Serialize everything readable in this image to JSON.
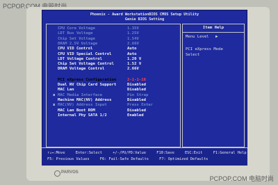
{
  "watermark": {
    "top": "PCPOP.COM 电脑时尚",
    "bottom": "PCPOP.COM 电脑时尚"
  },
  "bios": {
    "title": "Phoenix - Award WorkstationBIOS CMOS Setup Utility",
    "subtitle": "Genie BIOS Setting",
    "rows": [
      {
        "label": "CPU Core  Voltage",
        "value": "1.35V",
        "state": "dim"
      },
      {
        "label": "LDT Bus  Voltage",
        "value": "1.25V",
        "state": "dim"
      },
      {
        "label": "Chip Set  Voltage",
        "value": "1.54V",
        "state": "dim"
      },
      {
        "label": "DRAM 2.5V Voltage",
        "value": "2.66V",
        "state": "dim"
      },
      {
        "label": "CPU VID Control",
        "value": "Auto",
        "state": "norm"
      },
      {
        "label": "CPU VID Special Control",
        "value": "Auto",
        "state": "norm"
      },
      {
        "label": "LDT Voltage Control",
        "value": "1.20 V",
        "state": "norm"
      },
      {
        "label": "Chip Set Voltage Control",
        "value": "1.52 V",
        "state": "norm"
      },
      {
        "label": "DRAM Voltage Control",
        "value": "2.66V",
        "state": "norm"
      },
      {
        "label": "PCI eXpress Configuration",
        "value": "2-1-1-16",
        "state": "sel"
      },
      {
        "label": "Dual NV Chip Card Support",
        "value": "Disabled",
        "state": "norm"
      },
      {
        "label": "MAC Lan",
        "value": "Disabled",
        "state": "norm"
      },
      {
        "label": "MAC Media Interface",
        "value": "Pin Strap",
        "state": "dim",
        "mark": "x"
      },
      {
        "label": "Machine MAC(NV) Address",
        "value": "Disabled",
        "state": "norm"
      },
      {
        "label": "MAC(NV) Address Input",
        "value": "Press Enter",
        "state": "dim",
        "mark": "x"
      },
      {
        "label": "MAC Lan Boot ROM",
        "value": "Disabled",
        "state": "norm"
      },
      {
        "label": "Internal Phy SATA 1/2",
        "value": "Enabled",
        "state": "norm"
      }
    ],
    "help": {
      "title": "Item Help",
      "menu_level": "Menu Level",
      "menu_level_arrow": "▶",
      "text_1": "PCI eXpress Mode",
      "text_2": "Select"
    },
    "footer": {
      "line1": [
        "↑↓↔:Move",
        "Enter:Select",
        "+/-/PU/PD:Value",
        "F10:Save",
        "ESC:Exit",
        "F1:General Help"
      ],
      "line2": [
        "F5: Previous Values",
        "F6: Fail-Safe Defaults",
        "F7: Optimized Defaults"
      ]
    }
  },
  "monitor": {
    "brand": "PARVOS"
  },
  "colors": {
    "bios_bg": "#1e2a9e",
    "dim_text": "#6f86c9",
    "selected_value": "#ff4b4b"
  }
}
